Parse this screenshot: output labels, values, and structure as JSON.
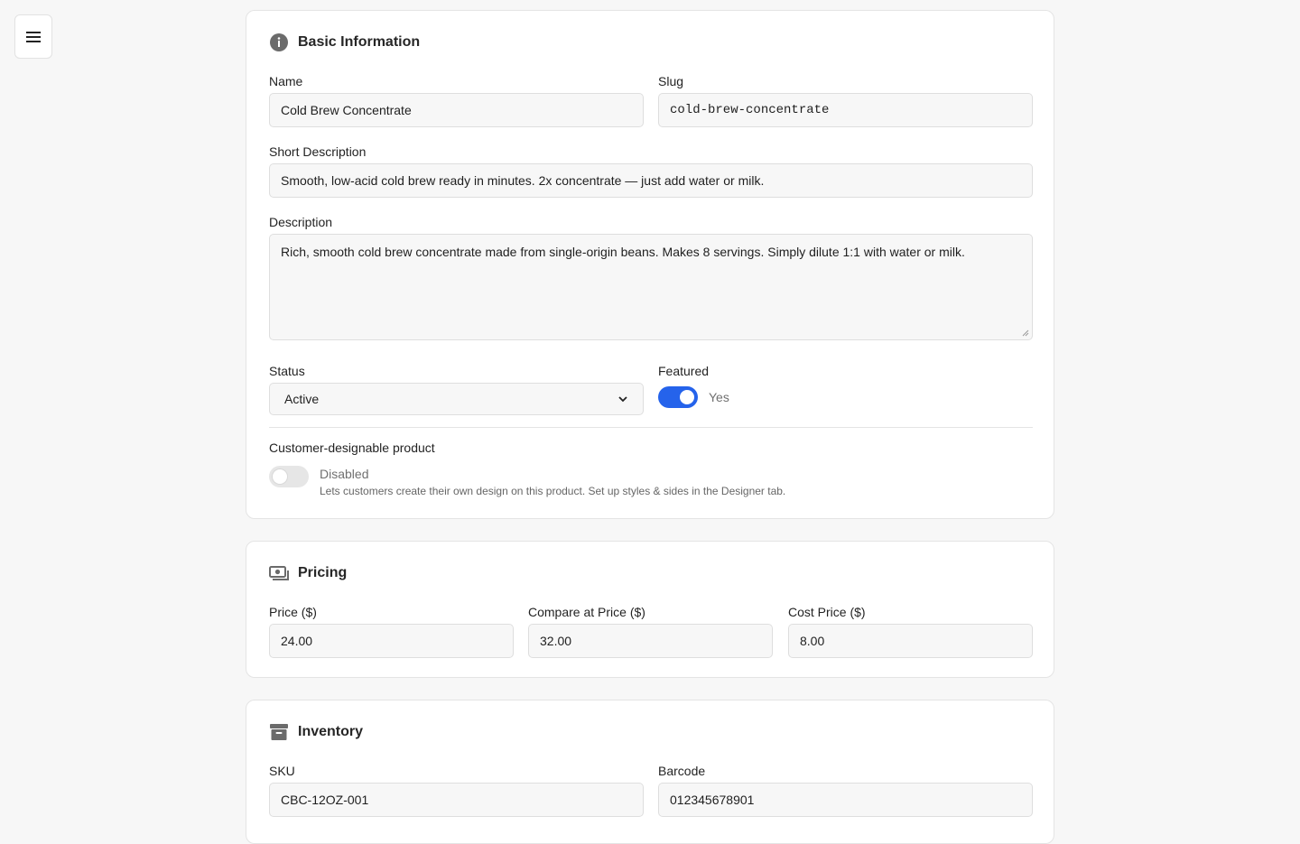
{
  "sections": {
    "basic": {
      "title": "Basic Information",
      "name_label": "Name",
      "name_value": "Cold Brew Concentrate",
      "slug_label": "Slug",
      "slug_value": "cold-brew-concentrate",
      "short_desc_label": "Short Description",
      "short_desc_value": "Smooth, low-acid cold brew ready in minutes. 2x concentrate — just add water or milk.",
      "desc_label": "Description",
      "desc_value": "Rich, smooth cold brew concentrate made from single-origin beans. Makes 8 servings. Simply dilute 1:1 with water or milk.",
      "status_label": "Status",
      "status_value": "Active",
      "featured_label": "Featured",
      "featured_value": "Yes",
      "featured_on": true,
      "designable_label": "Customer-designable product",
      "designable_value": "Disabled",
      "designable_on": false,
      "designable_help": "Lets customers create their own design on this product. Set up styles & sides in the Designer tab."
    },
    "pricing": {
      "title": "Pricing",
      "price_label": "Price ($)",
      "price_value": "24.00",
      "compare_label": "Compare at Price ($)",
      "compare_value": "32.00",
      "cost_label": "Cost Price ($)",
      "cost_value": "8.00"
    },
    "inventory": {
      "title": "Inventory",
      "sku_label": "SKU",
      "sku_value": "CBC-12OZ-001",
      "barcode_label": "Barcode",
      "barcode_value": "012345678901"
    }
  },
  "icons": {
    "menu": "hamburger-menu-icon",
    "basic": "info-circle-icon",
    "pricing": "money-bills-icon",
    "inventory": "archive-box-icon"
  },
  "colors": {
    "accent": "#2563eb",
    "icon": "#6b6b6b"
  }
}
